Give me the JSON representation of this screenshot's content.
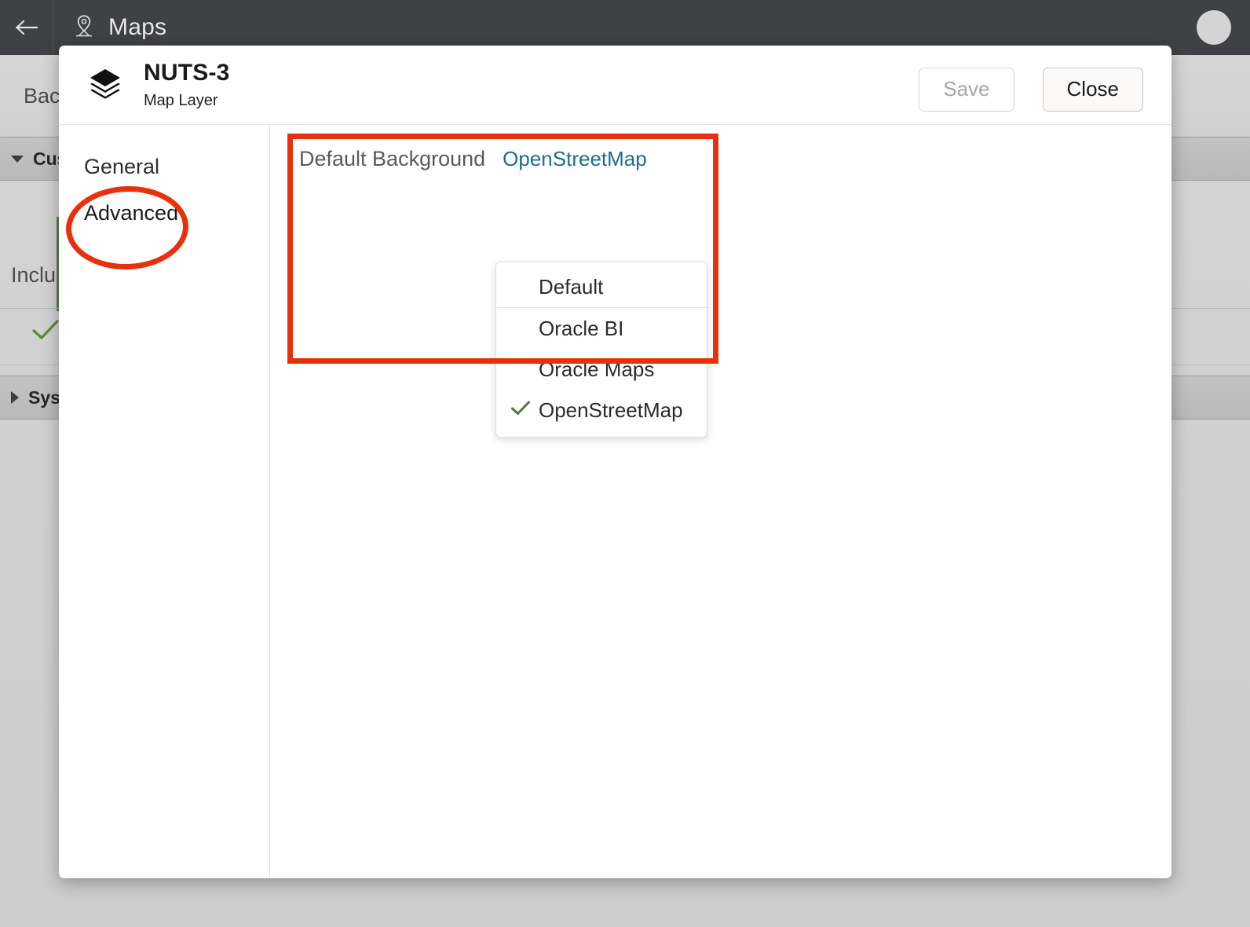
{
  "appbar": {
    "back_icon": "arrow-left-icon",
    "pin_icon": "map-pin-icon",
    "title": "Maps",
    "avatar_label": ""
  },
  "background_page": {
    "toolbar_label": "Bac",
    "sections": [
      {
        "label": "Cus",
        "expanded": true
      },
      {
        "label": "Syst",
        "expanded": false
      }
    ],
    "include_label": "Inclu",
    "check_icon": "check-icon",
    "add_icon": "plus-circle-icon",
    "accent_green": "#5e7f4c"
  },
  "dialog": {
    "icon": "layers-icon",
    "title": "NUTS-3",
    "subtitle": "Map Layer",
    "save_label": "Save",
    "save_disabled": true,
    "close_label": "Close",
    "nav": [
      {
        "label": "General",
        "active": false
      },
      {
        "label": "Advanced",
        "active": true
      }
    ],
    "field": {
      "label": "Default Background",
      "value": "OpenStreetMap",
      "value_color": "#1a6e8e"
    },
    "dropdown": {
      "options": [
        {
          "label": "Default",
          "selected": false,
          "divider_after": true
        },
        {
          "label": "Oracle BI",
          "selected": false,
          "divider_after": false
        },
        {
          "label": "Oracle Maps",
          "selected": false,
          "divider_after": false
        },
        {
          "label": "OpenStreetMap",
          "selected": true,
          "divider_after": false
        }
      ],
      "check_icon": "check-icon",
      "check_color": "#4a7a3a"
    }
  },
  "annotations": {
    "color": "#e8310c",
    "box_target": "Default Background field and dropdown",
    "ellipse_target": "Advanced"
  }
}
